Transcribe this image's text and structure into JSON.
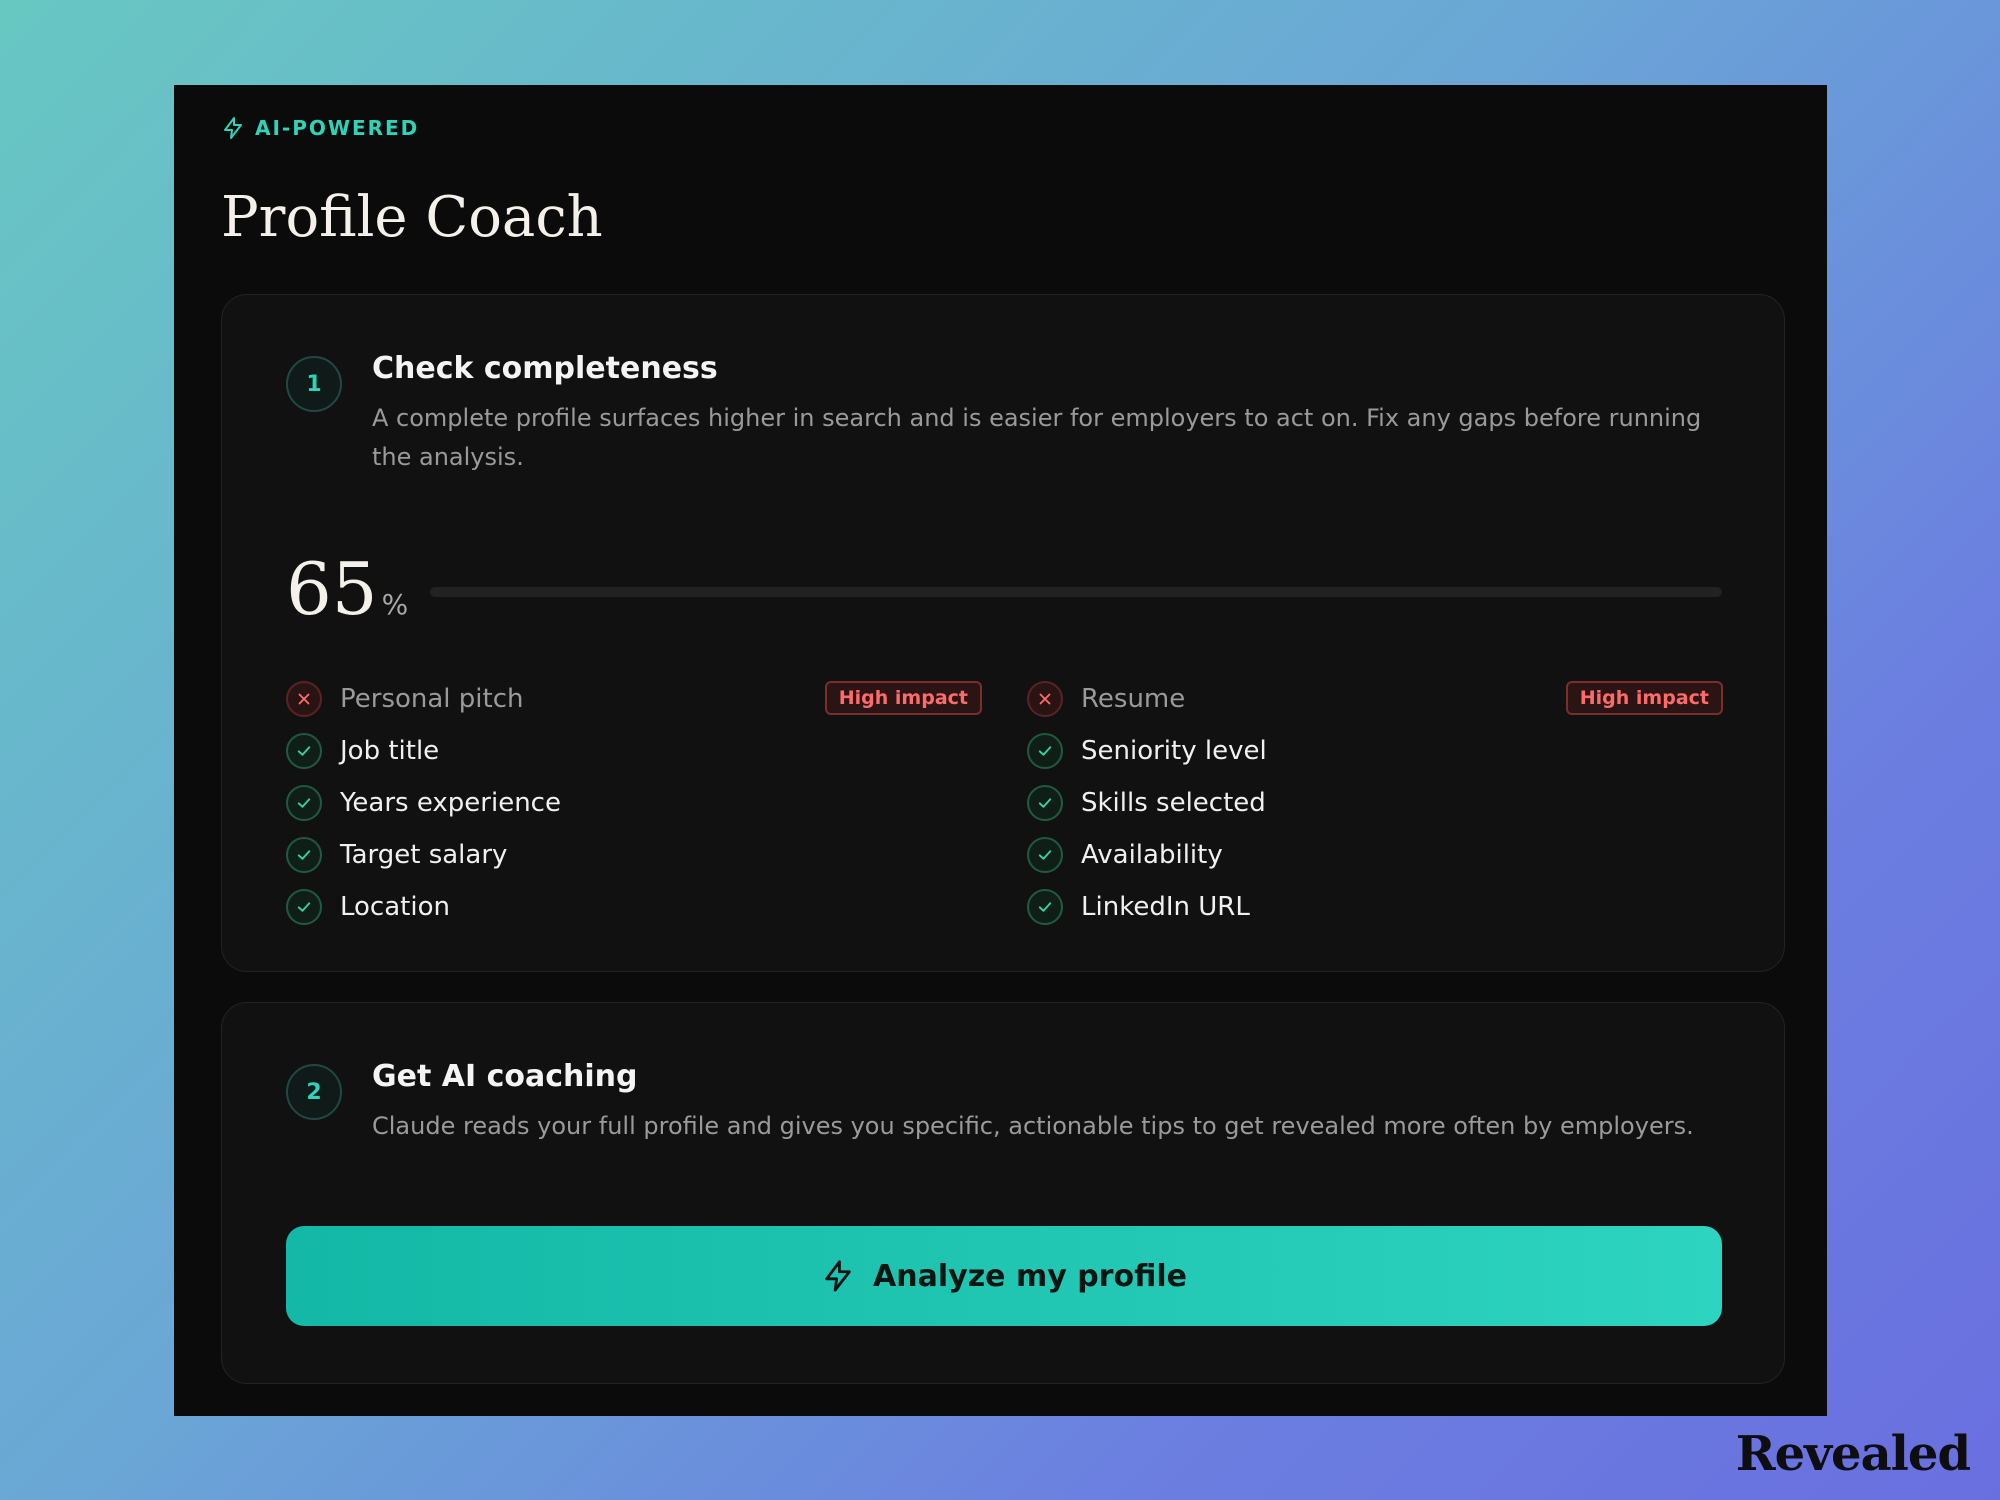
{
  "header": {
    "badge_icon": "bolt-icon",
    "badge": "AI-POWERED",
    "title": "Profile Coach",
    "accent_color": "#2fd3b8"
  },
  "step1": {
    "number": "1",
    "title": "Check completeness",
    "description": "A complete profile surfaces higher in search and is easier for employers to act on. Fix any gaps before running the analysis.",
    "completeness_value": "65",
    "completeness_unit": "%",
    "completeness_fraction": 0.65,
    "left_items": [
      {
        "label": "Personal pitch",
        "status": "missing",
        "tag": "High impact"
      },
      {
        "label": "Job title",
        "status": "complete"
      },
      {
        "label": "Years experience",
        "status": "complete"
      },
      {
        "label": "Target salary",
        "status": "complete"
      },
      {
        "label": "Location",
        "status": "complete"
      }
    ],
    "right_items": [
      {
        "label": "Resume",
        "status": "missing",
        "tag": "High impact"
      },
      {
        "label": "Seniority level",
        "status": "complete"
      },
      {
        "label": "Skills selected",
        "status": "complete"
      },
      {
        "label": "Availability",
        "status": "complete"
      },
      {
        "label": "LinkedIn URL",
        "status": "complete"
      }
    ]
  },
  "step2": {
    "number": "2",
    "title": "Get AI coaching",
    "description": "Claude reads your full profile and gives you specific, actionable tips to get revealed more often by employers.",
    "button_label": "Analyze my profile",
    "button_icon": "bolt-icon"
  },
  "brand": {
    "name": "Revealed"
  }
}
